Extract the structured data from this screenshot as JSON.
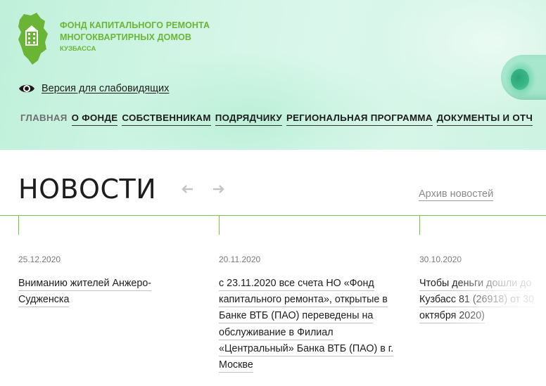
{
  "header": {
    "org_name_line1": "ФОНД КАПИТАЛЬНОГО РЕМОНТА",
    "org_name_line2": "МНОГОКВАРТИРНЫХ ДОМОВ",
    "org_region": "КУЗБАССА",
    "accessibility_label": "Версия для слабовидящих",
    "brand_color": "#6bb536"
  },
  "nav": {
    "items": [
      {
        "label": "ГЛАВНАЯ",
        "active": true
      },
      {
        "label": "О ФОНДЕ"
      },
      {
        "label": "СОБСТВЕННИКАМ"
      },
      {
        "label": "ПОДРЯДЧИКУ"
      },
      {
        "label": "РЕГИОНАЛЬНАЯ ПРОГРАММА"
      },
      {
        "label": "ДОКУМЕНТЫ И ОТЧ"
      }
    ]
  },
  "news": {
    "title": "НОВОСТИ",
    "archive_label": "Архив новостей",
    "items": [
      {
        "date": "25.12.2020",
        "text": "Вниманию жителей Анжеро-Судженска"
      },
      {
        "date": "20.11.2020",
        "text": "с 23.11.2020 все счета НО «Фонд капитального ремонта», открытые в Банке ВТБ (ПАО) переведены на обслуживание в Филиал «Центральный» Банка ВТБ (ПАО) в г. Москве"
      },
      {
        "date": "30.10.2020",
        "text": "Чтобы деньги дошли до Кузбасс 81 (26918) от 30 октября 2020)"
      }
    ]
  },
  "icons": {
    "logo": "kuzbass-region-house-logo",
    "accessibility": "eye-icon",
    "prev": "arrow-left-icon",
    "next": "arrow-right-icon"
  }
}
